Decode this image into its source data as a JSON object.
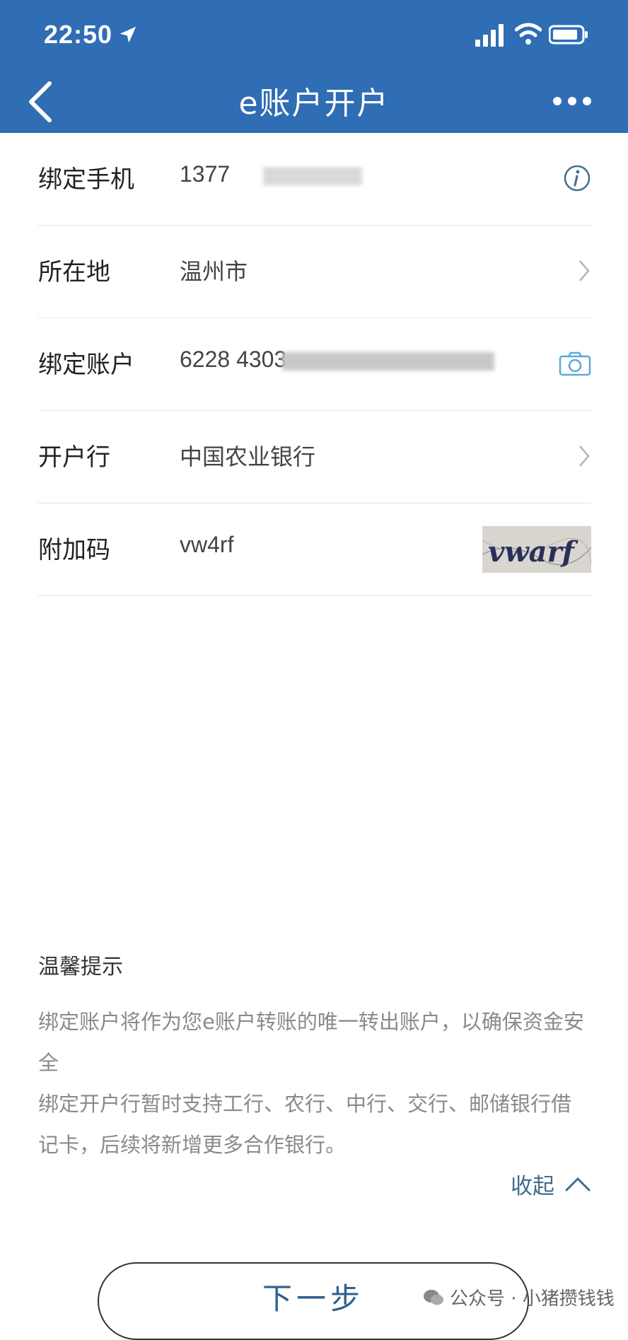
{
  "status_bar": {
    "time": "22:50"
  },
  "nav": {
    "title": "e账户开户"
  },
  "form": {
    "rows": [
      {
        "label": "绑定手机",
        "value": "1377"
      },
      {
        "label": "所在地",
        "value": "温州市"
      },
      {
        "label": "绑定账户",
        "value": "6228 4303"
      },
      {
        "label": "开户行",
        "value": "中国农业银行"
      },
      {
        "label": "附加码",
        "value": "vw4rf",
        "captcha_text": "vwarf"
      }
    ]
  },
  "tips": {
    "title": "温馨提示",
    "line1": "绑定账户将作为您e账户转账的唯一转出账户，以确保资金安",
    "line1b": "全",
    "line2": "绑定开户行暂时支持工行、农行、中行、交行、邮储银行借",
    "line2b": "记卡，后续将新增更多合作银行。",
    "collapse_label": "收起"
  },
  "next_button": {
    "label": "下一步"
  },
  "watermark": {
    "text": "公众号 · 小猪攒钱钱"
  },
  "colors": {
    "header": "#2f6db5",
    "accent": "#3f6e8c"
  }
}
